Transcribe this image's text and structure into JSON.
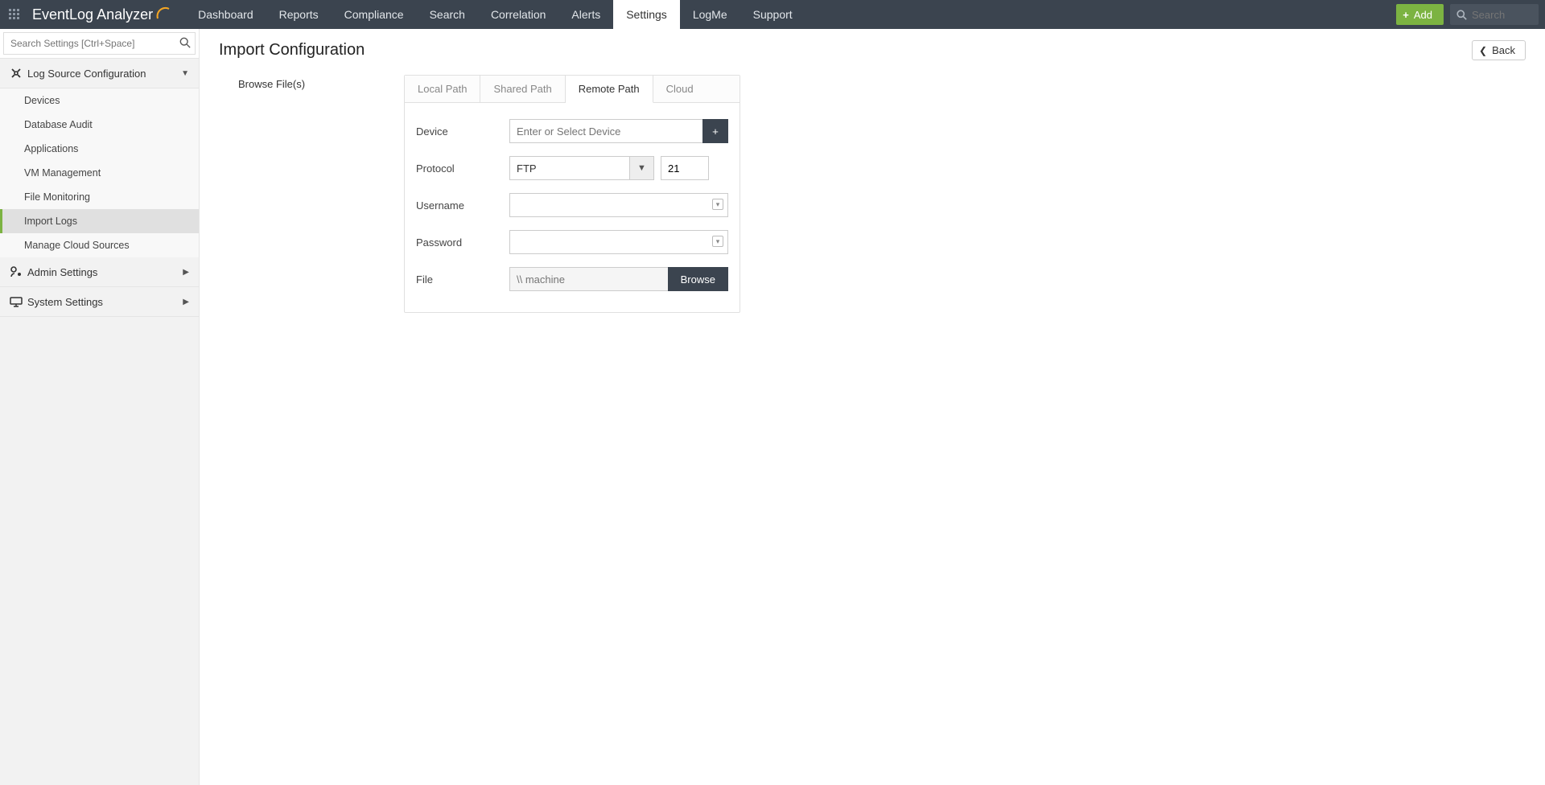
{
  "brand": {
    "name": "EventLog Analyzer"
  },
  "topnav": {
    "items": [
      "Dashboard",
      "Reports",
      "Compliance",
      "Search",
      "Correlation",
      "Alerts",
      "Settings",
      "LogMe",
      "Support"
    ],
    "activeIndex": 6,
    "addLabel": "Add",
    "searchPlaceholder": "Search"
  },
  "sidebar": {
    "searchPlaceholder": "Search Settings [Ctrl+Space]",
    "sections": [
      {
        "title": "Log Source Configuration",
        "expanded": true,
        "items": [
          "Devices",
          "Database Audit",
          "Applications",
          "VM Management",
          "File Monitoring",
          "Import Logs",
          "Manage Cloud Sources"
        ],
        "activeIndex": 5
      },
      {
        "title": "Admin Settings",
        "expanded": false
      },
      {
        "title": "System Settings",
        "expanded": false
      }
    ]
  },
  "page": {
    "title": "Import Configuration",
    "backLabel": "Back",
    "stepLabel": "Browse File(s)"
  },
  "tabs": {
    "items": [
      "Local Path",
      "Shared Path",
      "Remote Path",
      "Cloud"
    ],
    "activeIndex": 2
  },
  "form": {
    "deviceLabel": "Device",
    "devicePlaceholder": "Enter or Select Device",
    "protocolLabel": "Protocol",
    "protocolValue": "FTP",
    "portValue": "21",
    "usernameLabel": "Username",
    "usernameValue": "",
    "passwordLabel": "Password",
    "passwordValue": "",
    "fileLabel": "File",
    "filePlaceholder": "\\\\ machine",
    "browseLabel": "Browse"
  }
}
